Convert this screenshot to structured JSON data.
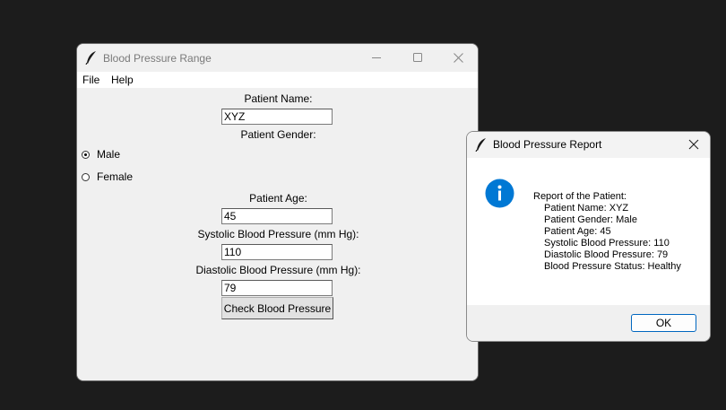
{
  "main_window": {
    "title": "Blood Pressure Range",
    "menu": [
      "File",
      "Help"
    ],
    "labels": {
      "name": "Patient Name:",
      "gender": "Patient Gender:",
      "age": "Patient Age:",
      "systolic": "Systolic Blood Pressure (mm Hg):",
      "diastolic": "Diastolic Blood Pressure (mm Hg):"
    },
    "fields": {
      "name": "XYZ",
      "age": "45",
      "systolic": "110",
      "diastolic": "79"
    },
    "gender_options": [
      {
        "label": "Male",
        "selected": true
      },
      {
        "label": "Female",
        "selected": false
      }
    ],
    "check_button": "Check Blood Pressure"
  },
  "report_dialog": {
    "title": "Blood Pressure Report",
    "heading": "Report of the Patient:",
    "lines": [
      "Patient Name: XYZ",
      "Patient Gender: Male",
      "Patient Age: 45",
      "Systolic Blood Pressure: 110",
      "Diastolic Blood Pressure: 79",
      "Blood Pressure Status: Healthy"
    ],
    "ok_button": "OK",
    "icon": "info-icon"
  },
  "colors": {
    "desktop": "#1c1c1c",
    "window_bg": "#f0f0f0",
    "info_blue": "#0078d4",
    "ok_border": "#0067c0"
  }
}
